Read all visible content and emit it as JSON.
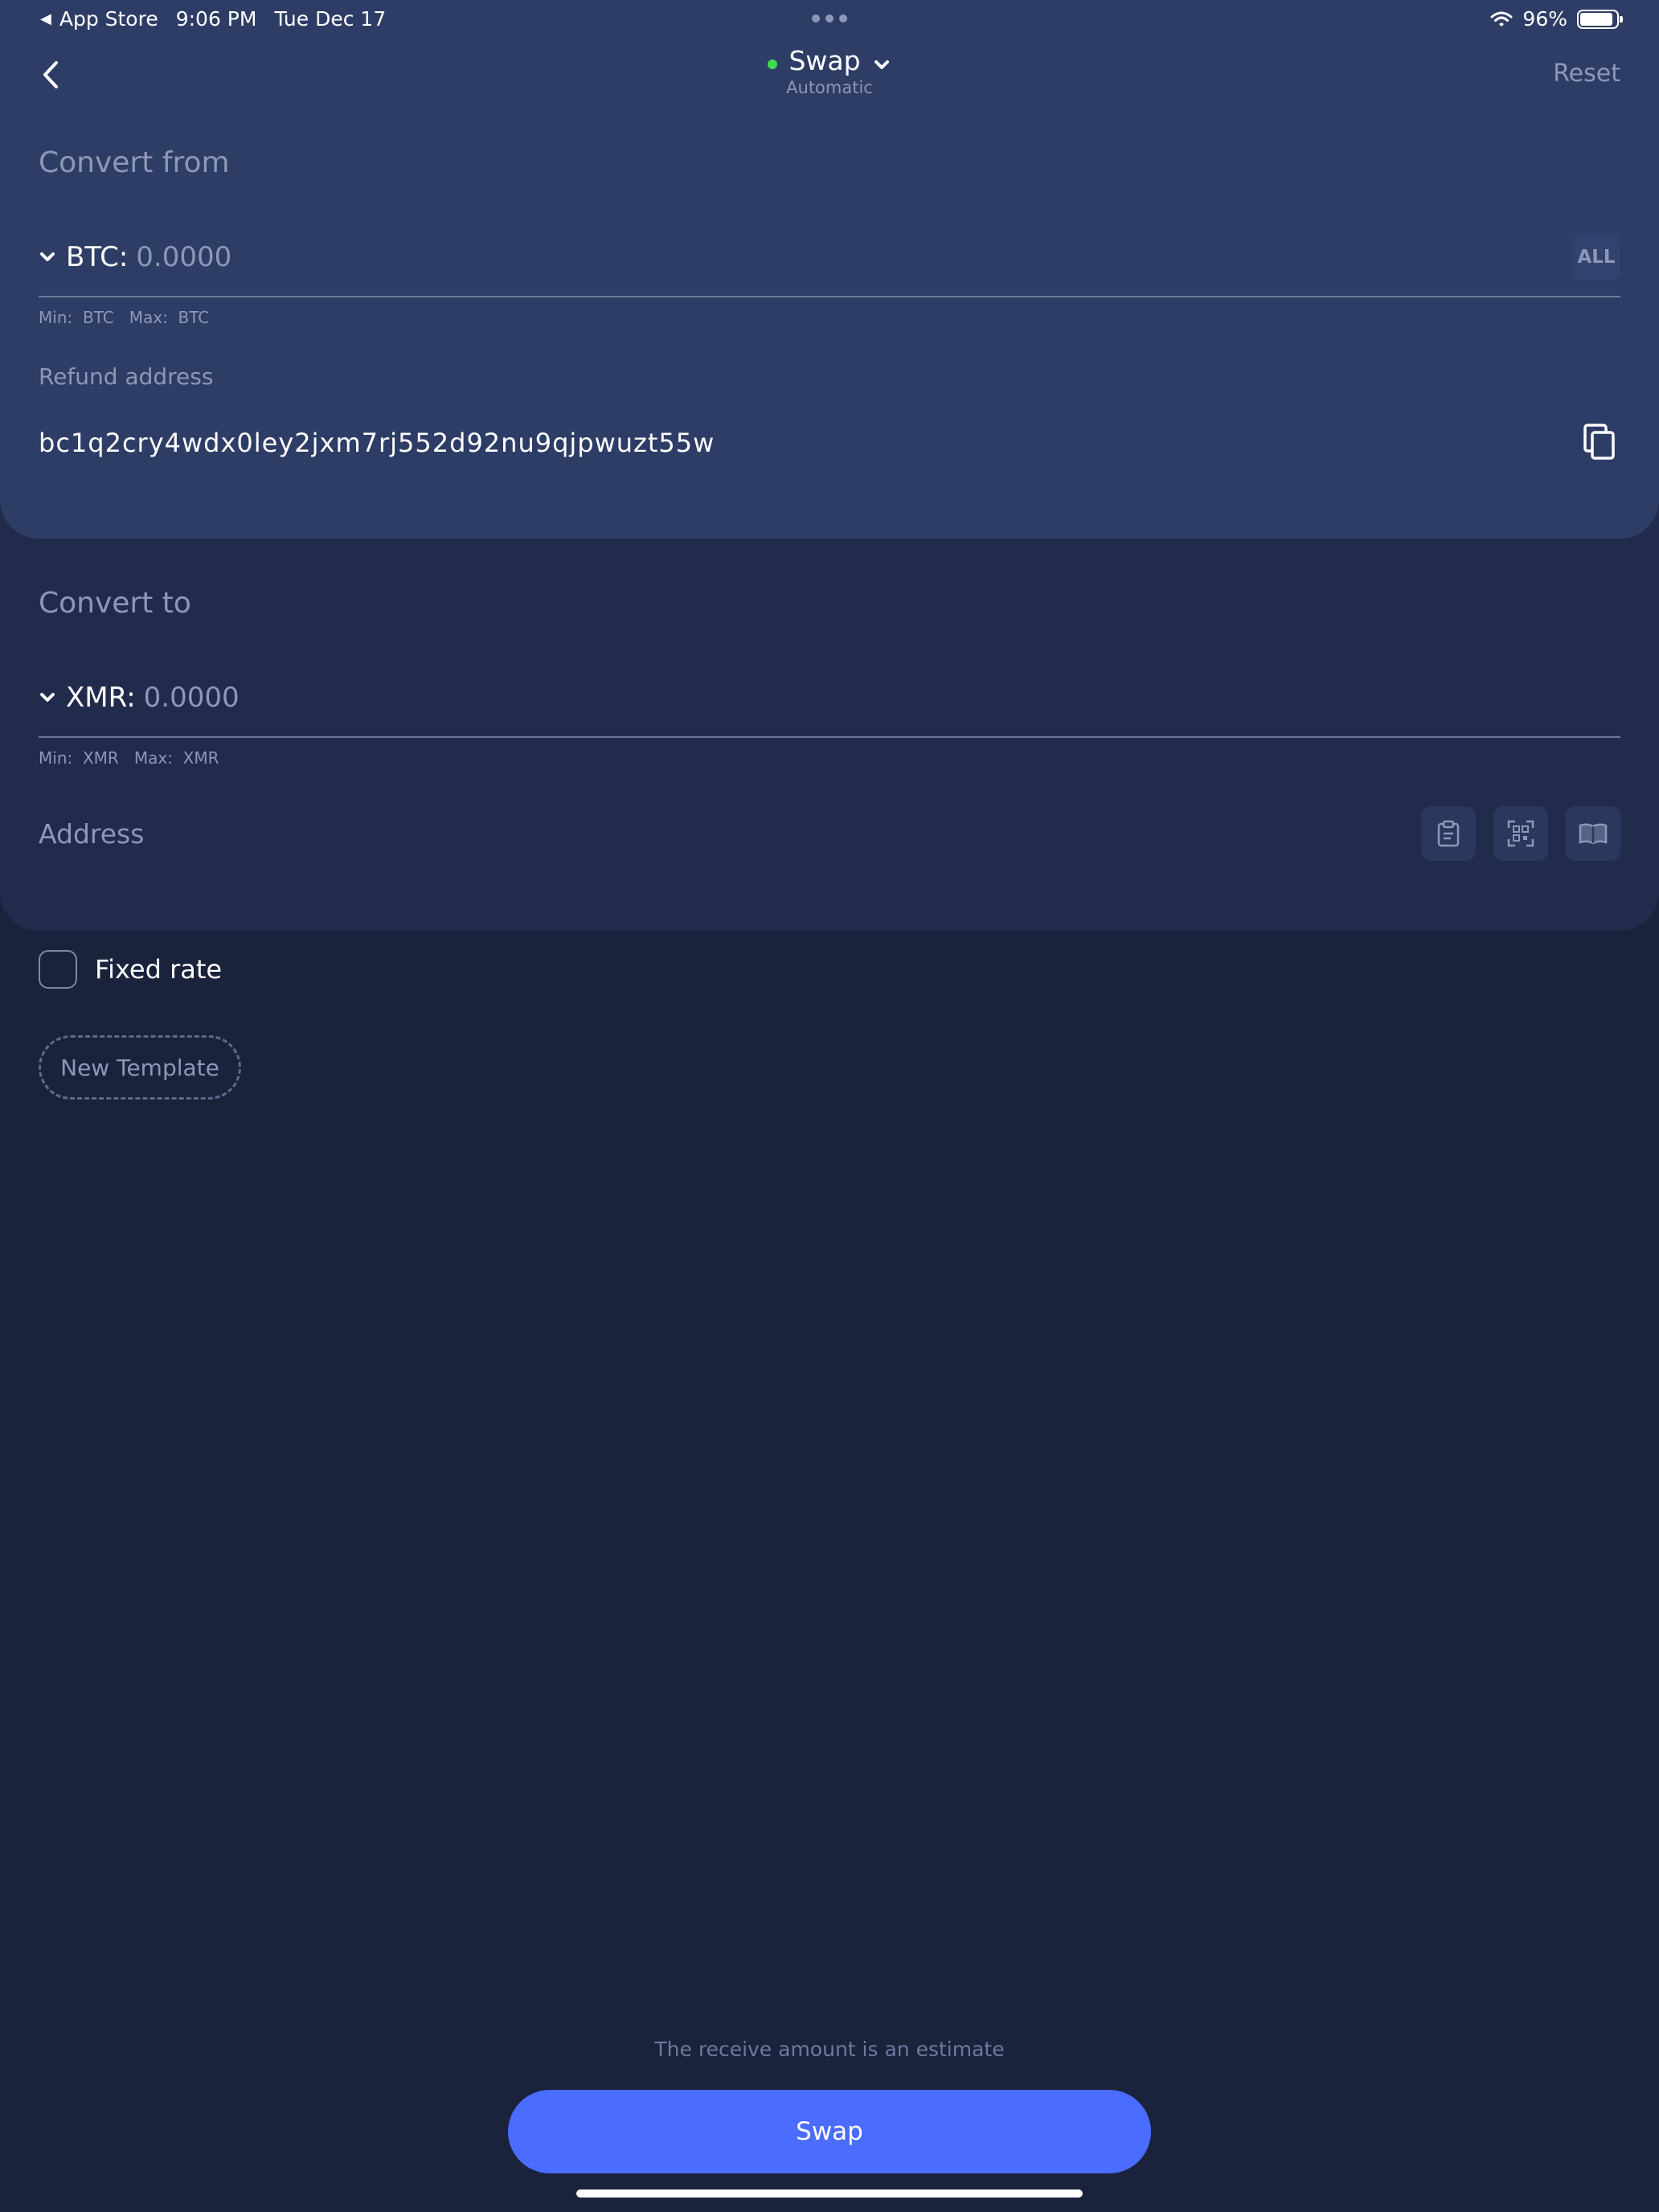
{
  "status_bar": {
    "back_app": "App Store",
    "time": "9:06 PM",
    "date": "Tue Dec 17",
    "battery": "96%"
  },
  "nav": {
    "title": "Swap",
    "subtitle": "Automatic",
    "reset_label": "Reset"
  },
  "convert_from": {
    "title": "Convert from",
    "currency": "BTC:",
    "amount_placeholder": "0.0000",
    "all_label": "ALL",
    "limits": "Min:  BTC   Max:  BTC",
    "refund_label": "Refund address",
    "refund_address": "bc1q2cry4wdx0ley2jxm7rj552d92nu9qjpwuzt55w"
  },
  "convert_to": {
    "title": "Convert to",
    "currency": "XMR:",
    "amount_placeholder": "0.0000",
    "limits": "Min:  XMR   Max:  XMR",
    "address_label": "Address"
  },
  "options": {
    "fixed_rate_label": "Fixed rate",
    "new_template_label": "New Template"
  },
  "footer": {
    "estimate_note": "The receive amount is an estimate",
    "swap_label": "Swap"
  },
  "colors": {
    "background": "#1a223c",
    "card_from": "#2e3d66",
    "card_to": "#212c4d",
    "accent": "#4a6cff",
    "online": "#3ddc4a"
  }
}
